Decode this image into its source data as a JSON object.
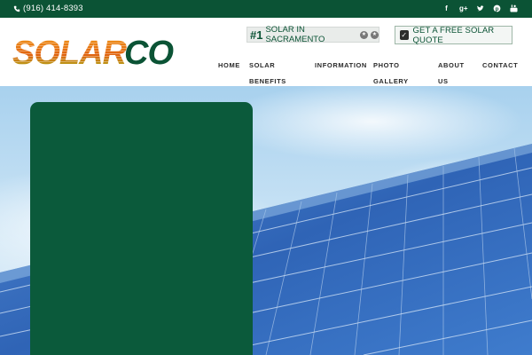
{
  "topbar": {
    "phone": "(916) 414-8393",
    "phone_icon": "phone-icon",
    "socials": [
      "facebook-icon",
      "google-plus-icon",
      "twitter-icon",
      "pinterest-icon",
      "youtube-icon"
    ]
  },
  "logo": {
    "text_part1": "SOLAR",
    "text_part2": "CO",
    "colors": {
      "solar": "#e07a10",
      "co": "#0b5335",
      "stripe": "#9ac31c"
    }
  },
  "badge": {
    "number": "#1",
    "text": "SOLAR IN SACRAMENTO"
  },
  "quote_button": {
    "label": "GET A FREE SOLAR QUOTE",
    "icon": "checkbox-icon"
  },
  "nav": {
    "items": [
      {
        "line1": "HOME",
        "line2": ""
      },
      {
        "line1": "SOLAR",
        "line2": "BENEFITS"
      },
      {
        "line1": "INFORMATION",
        "line2": ""
      },
      {
        "line1": "PHOTO",
        "line2": "GALLERY"
      },
      {
        "line1": "ABOUT",
        "line2": "US"
      },
      {
        "line1": "CONTACT",
        "line2": ""
      }
    ]
  },
  "colors": {
    "brand_green": "#0b5335",
    "panel_green": "#0b5a3b",
    "sky": "#8fc2e6"
  }
}
